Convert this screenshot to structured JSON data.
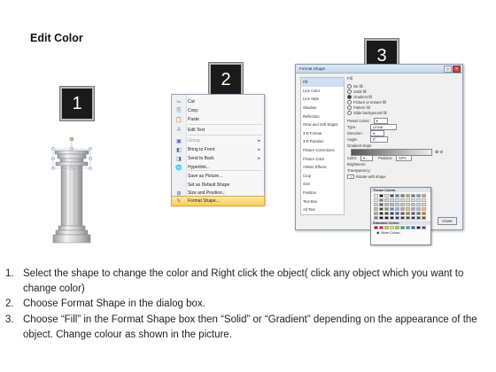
{
  "title": "Edit Color",
  "step_numbers": [
    "1",
    "2",
    "3"
  ],
  "context_menu": {
    "items": [
      {
        "icon": "cut-icon",
        "glyph": "✂",
        "label": "Cut"
      },
      {
        "icon": "copy-icon",
        "glyph": "⎘",
        "label": "Copy"
      },
      {
        "icon": "paste-icon",
        "glyph": "📋",
        "label": "Paste"
      },
      {
        "icon": "edit-text-icon",
        "glyph": "A",
        "label": "Edit Text"
      },
      {
        "icon": "group-icon",
        "glyph": "▣",
        "label": "Group",
        "disabled": true,
        "submenu": true
      },
      {
        "icon": "bring-to-front-icon",
        "glyph": "◧",
        "label": "Bring to Front",
        "submenu": true
      },
      {
        "icon": "send-to-back-icon",
        "glyph": "◨",
        "label": "Send to Back",
        "submenu": true
      },
      {
        "icon": "hyperlink-icon",
        "glyph": "🌐",
        "label": "Hyperlink..."
      },
      {
        "icon": "",
        "glyph": "",
        "label": "Save as Picture..."
      },
      {
        "icon": "",
        "glyph": "",
        "label": "Set as Default Shape"
      },
      {
        "icon": "size-position-icon",
        "glyph": "⊞",
        "label": "Size and Position..."
      },
      {
        "icon": "format-shape-icon",
        "glyph": "✎",
        "label": "Format Shape...",
        "highlighted": true
      }
    ]
  },
  "format_shape_dialog": {
    "title": "Format Shape",
    "nav": [
      "Fill",
      "Line Color",
      "Line Style",
      "Shadow",
      "Reflection",
      "Glow and Soft Edges",
      "3-D Format",
      "3-D Rotation",
      "Picture Corrections",
      "Picture Color",
      "Artistic Effects",
      "Crop",
      "Size",
      "Position",
      "Text Box",
      "Alt Text"
    ],
    "fill_heading": "Fill",
    "fill_options": [
      "No fill",
      "Solid fill",
      "Gradient fill",
      "Picture or texture fill",
      "Pattern fill",
      "Slide background fill"
    ],
    "selected_fill": 2,
    "preset_colors_label": "Preset colors:",
    "type_label": "Type:",
    "type_value": "Linear",
    "direction_label": "Direction:",
    "angle_label": "Angle:",
    "angle_value": "0°",
    "gradient_stops_label": "Gradient stops",
    "color_label": "Color:",
    "position_label": "Position:",
    "position_value": "50%",
    "brightness_label": "Brightness:",
    "transparency_label": "Transparency:",
    "rotate_label": "Rotate with shape",
    "close_label": "Close"
  },
  "palette": {
    "theme_colors_label": "Theme Colors",
    "standard_colors_label": "Standard Colors",
    "more_colors_label": "More Colors...",
    "theme_top": [
      "#ffffff",
      "#000000",
      "#eeece1",
      "#1f497d",
      "#4f81bd",
      "#c0504d",
      "#9bbb59",
      "#8064a2",
      "#4bacc6",
      "#f79646"
    ],
    "theme_rows": [
      [
        "#f2f2f2",
        "#7f7f7f",
        "#ddd9c3",
        "#c6d9f0",
        "#dbe5f1",
        "#f2dcdb",
        "#ebf1dd",
        "#e5e0ec",
        "#dbeef3",
        "#fdeada"
      ],
      [
        "#d8d8d8",
        "#595959",
        "#c4bd97",
        "#8db3e2",
        "#b8cce4",
        "#e5b9b7",
        "#d7e3bc",
        "#ccc1d9",
        "#b7dde8",
        "#fbd5b5"
      ],
      [
        "#bfbfbf",
        "#3f3f3f",
        "#938953",
        "#548dd4",
        "#95b3d7",
        "#d99694",
        "#c3d69b",
        "#b2a2c7",
        "#92cddc",
        "#fac08f"
      ],
      [
        "#a5a5a5",
        "#262626",
        "#494429",
        "#17365d",
        "#366092",
        "#953734",
        "#76923c",
        "#5f497a",
        "#31859b",
        "#e36c09"
      ],
      [
        "#7f7f7f",
        "#0c0c0c",
        "#1d1b10",
        "#0f243e",
        "#244061",
        "#632423",
        "#4f6128",
        "#3f3151",
        "#205867",
        "#974806"
      ]
    ],
    "standard": [
      "#c00000",
      "#ff0000",
      "#ffc000",
      "#ffff00",
      "#92d050",
      "#00b050",
      "#00b0f0",
      "#0070c0",
      "#002060",
      "#7030a0"
    ]
  },
  "instructions": [
    {
      "num": "1.",
      "text": "Select the shape to change the color and Right click the object( click any object which you want to change color)"
    },
    {
      "num": "2.",
      "text": "Choose Format Shape in the dialog box."
    },
    {
      "num": "3.",
      "text": "Choose “Fill” in the Format Shape box then “Solid” or “Gradient” depending on the appearance of the object. Change colour as shown in the picture."
    }
  ]
}
